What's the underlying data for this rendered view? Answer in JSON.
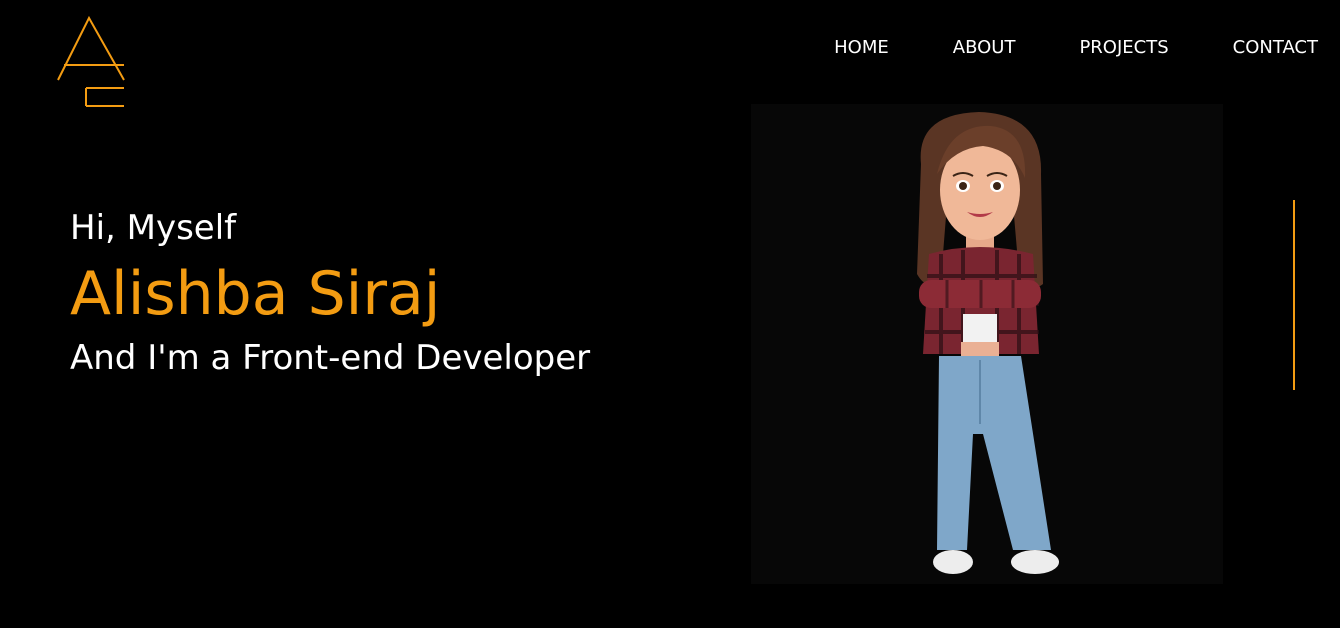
{
  "colors": {
    "background": "#000000",
    "text": "#ffffff",
    "accent": "#f39c12"
  },
  "logo": {
    "icon": "ae-monogram-logo"
  },
  "nav": {
    "items": [
      {
        "label": "HOME"
      },
      {
        "label": "ABOUT"
      },
      {
        "label": "PROJECTS"
      },
      {
        "label": "CONTACT"
      }
    ]
  },
  "hero": {
    "greeting": "Hi, Myself",
    "name": "Alishba Siraj",
    "role": "And I'm a Front-end Developer",
    "avatar_icon": "cartoon-avatar-illustration"
  }
}
